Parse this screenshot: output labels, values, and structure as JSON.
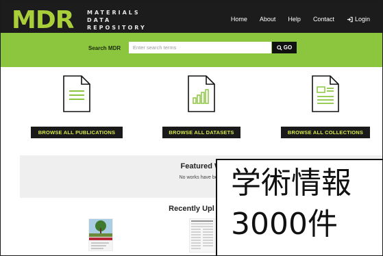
{
  "header": {
    "logo": "MDR",
    "logo_sub": [
      "MATERIALS",
      "DATA",
      "REPOSITORY"
    ],
    "nav": [
      "Home",
      "About",
      "Help",
      "Contact",
      "Login"
    ]
  },
  "search": {
    "label": "Search MDR",
    "placeholder": "Enter search terms",
    "button": "GO"
  },
  "browse": {
    "publications": "BROWSE ALL PUBLICATIONS",
    "datasets": "BROWSE ALL DATASETS",
    "collections": "BROWSE ALL COLLECTIONS"
  },
  "featured": {
    "title": "Featured W",
    "note": "No works have been"
  },
  "recent": {
    "title": "Recently Upl"
  },
  "overlay": {
    "line1": "学術情報",
    "line2": "3000件"
  },
  "colors": {
    "accent": "#8cc63f",
    "logo": "#a8cf3a",
    "header_bg": "#1c1c1c"
  }
}
